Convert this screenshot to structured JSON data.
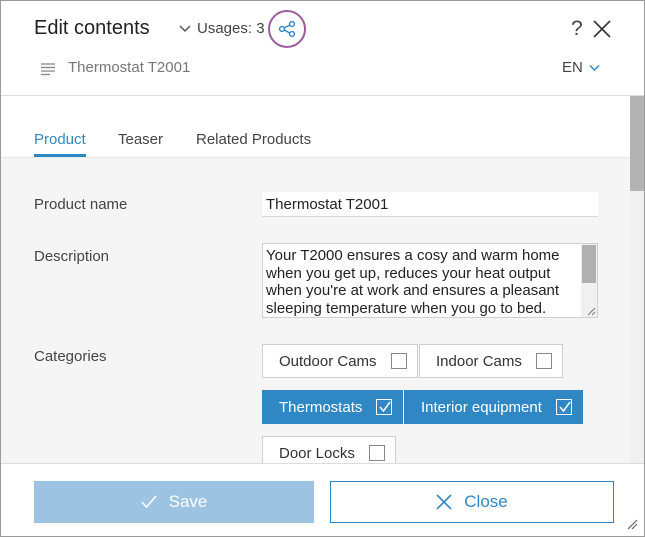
{
  "header": {
    "title": "Edit contents",
    "usages_label": "Usages: 3",
    "help": "?",
    "document_name": "Thermostat T2001",
    "language": "EN"
  },
  "tabs": [
    {
      "label": "Product",
      "active": true
    },
    {
      "label": "Teaser",
      "active": false
    },
    {
      "label": "Related Products",
      "active": false
    }
  ],
  "form": {
    "product_name_label": "Product name",
    "product_name_value": "Thermostat T2001",
    "description_label": "Description",
    "description_value": "Your T2000 ensures a cosy and warm home when you get up, reduces your heat output when you're at work and ensures a pleasant sleeping temperature when you go to bed.",
    "categories_label": "Categories",
    "categories": [
      {
        "label": "Outdoor Cams",
        "checked": false
      },
      {
        "label": "Indoor Cams",
        "checked": false
      },
      {
        "label": "Thermostats",
        "checked": true
      },
      {
        "label": "Interior equipment",
        "checked": true
      },
      {
        "label": "Door Locks",
        "checked": false
      }
    ]
  },
  "footer": {
    "save_label": "Save",
    "close_label": "Close"
  },
  "colors": {
    "accent": "#2f87c3",
    "save_disabled": "#9cc3e2",
    "highlight_ring": "#9b5c9b"
  },
  "icons": {
    "usages_toggle": "chevron-down-icon",
    "usages_graph": "share-graph-icon",
    "close": "close-icon",
    "document": "document-lines-icon",
    "language": "chevron-down-icon",
    "save": "check-icon",
    "close_button": "close-icon"
  }
}
